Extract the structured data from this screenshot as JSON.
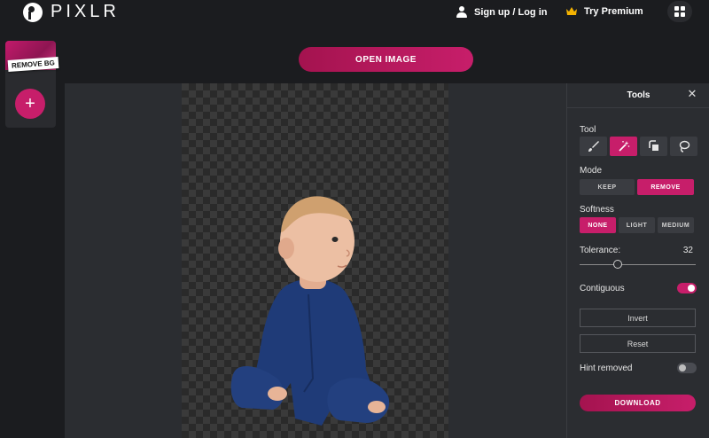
{
  "app": {
    "logo_text": "PIXLR"
  },
  "nav": {
    "signup_label": "Sign up / Log in",
    "premium_label": "Try Premium"
  },
  "left_strip": {
    "thumbnail_label": "REMOVE BG",
    "add_label": "+"
  },
  "canvas": {
    "open_image_label": "OPEN IMAGE"
  },
  "tools_panel": {
    "title": "Tools",
    "close_glyph": "✕",
    "tool_label": "Tool",
    "tools": [
      {
        "icon": "brush-icon",
        "active": false
      },
      {
        "icon": "magic-wand-icon",
        "active": true
      },
      {
        "icon": "shapes-icon",
        "active": false
      },
      {
        "icon": "lasso-icon",
        "active": false
      }
    ],
    "mode_label": "Mode",
    "modes": [
      {
        "label": "KEEP",
        "active": false
      },
      {
        "label": "REMOVE",
        "active": true
      }
    ],
    "softness_label": "Softness",
    "softness": [
      {
        "label": "NONE",
        "active": true
      },
      {
        "label": "LIGHT",
        "active": false
      },
      {
        "label": "MEDIUM",
        "active": false
      }
    ],
    "tolerance_label": "Tolerance:",
    "tolerance_value": "32",
    "tolerance_fraction": 0.33,
    "contiguous_label": "Contiguous",
    "contiguous_on": true,
    "invert_label": "Invert",
    "reset_label": "Reset",
    "hint_removed_label": "Hint removed",
    "hint_removed_on": false,
    "download_label": "DOWNLOAD"
  },
  "colors": {
    "accent": "#c71e6a",
    "background": "#1b1c1f",
    "panel": "#2b2d31"
  }
}
